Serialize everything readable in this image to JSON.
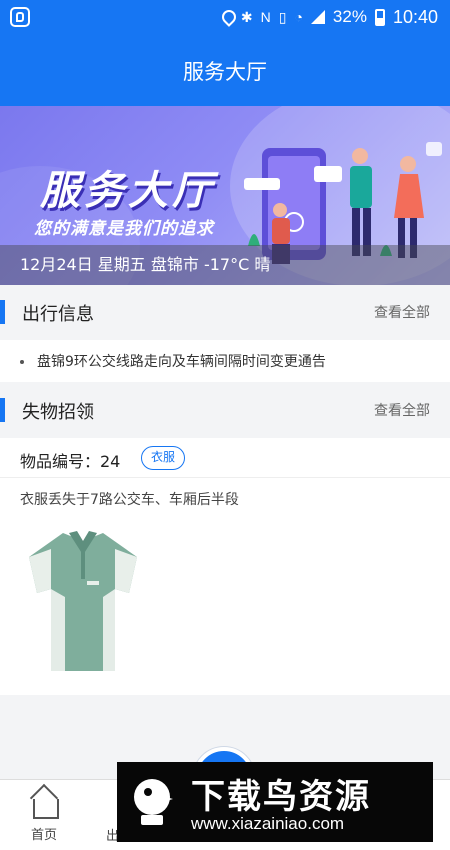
{
  "status_bar": {
    "battery": "32%",
    "time": "10:40",
    "icons": [
      "location-icon",
      "bluetooth-icon",
      "nfc-icon",
      "vibrate-icon",
      "wifi-icon",
      "signal-icon",
      "battery-icon"
    ]
  },
  "header": {
    "title": "服务大厅"
  },
  "banner": {
    "headline": "服务大厅",
    "slogan": "您的满意是我们的追求",
    "weather": "12月24日 星期五 盘锦市 -17°C 晴"
  },
  "travel": {
    "title": "出行信息",
    "more": "查看全部",
    "items": [
      "盘锦9环公交线路走向及车辆间隔时间变更通告"
    ]
  },
  "lost_found": {
    "title": "失物招领",
    "more": "查看全部",
    "item_number": "物品编号：24",
    "tag": "衣服",
    "description": "衣服丢失于7路公交车、车厢后半段",
    "image_icon": "polo-shirt-image"
  },
  "tabbar": {
    "home": "首页",
    "second_partial": "出"
  },
  "watermark": {
    "title": "下载鸟资源",
    "url": "www.xiazainiao.com"
  },
  "colors": {
    "primary": "#1676f3",
    "banner": "#8f8cf5",
    "background": "#f3f4f6"
  }
}
